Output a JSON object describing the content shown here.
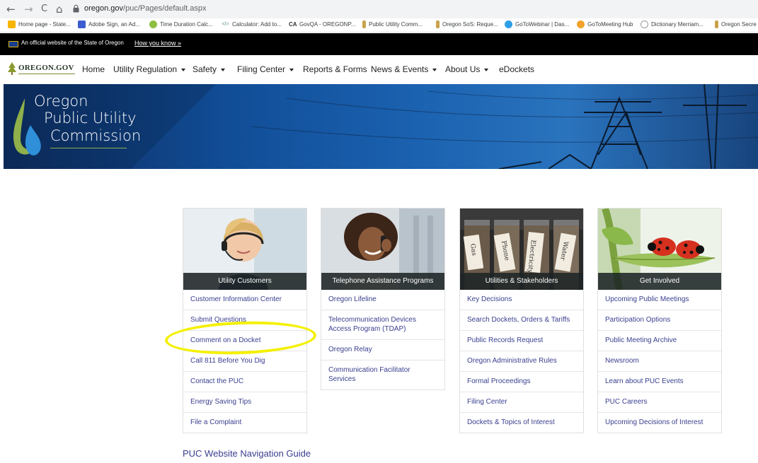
{
  "browser": {
    "nav": {
      "back": "←",
      "forward": "→",
      "reload": "C",
      "home": "⌂"
    },
    "url_domain": "oregon.gov",
    "url_path": "/puc/Pages/default.aspx",
    "bookmarks": [
      "Home page - State...",
      "Adobe Sign, an Ad...",
      "Time Duration Calc...",
      "Calculator: Add to...",
      "GovQA - OREGONP...",
      "Public Utility Comm...",
      "Oregon SoS: Reque...",
      "GoToWebinar | Das...",
      "GoToMeeting Hub",
      "Dictionary Merriam...",
      "Oregon Secre"
    ]
  },
  "official_bar": {
    "text": "An official website of the State of Oregon",
    "link": "How you know »"
  },
  "site": {
    "logo": "OREGON.GOV",
    "nav": [
      {
        "label": "Home",
        "dropdown": false
      },
      {
        "label": "Utility Regulation",
        "dropdown": true
      },
      {
        "label": "Safety",
        "dropdown": true
      },
      {
        "label": "Filing Center",
        "dropdown": true
      },
      {
        "label": "Reports & Forms",
        "dropdown": false
      },
      {
        "label": "News & Events",
        "dropdown": true
      },
      {
        "label": "About Us",
        "dropdown": true
      },
      {
        "label": "eDockets",
        "dropdown": false
      }
    ]
  },
  "banner": {
    "line1": "Oregon",
    "line2": "Public Utility",
    "line3": "Commission"
  },
  "cards": [
    {
      "caption": "Utility Customers",
      "links": [
        "Customer Information Center",
        "Submit Questions",
        "Comment on a Docket",
        "Call 811 Before You Dig",
        "Contact the PUC",
        "Energy Saving Tips",
        "File a Complaint"
      ]
    },
    {
      "caption": "Telephone Assistance Programs",
      "links": [
        "Oregon Lifeline",
        "Telecommunication Devices Access Program (TDAP)",
        "Oregon Relay",
        "Communication Facilitator Services"
      ]
    },
    {
      "caption": "Utilities & Stakeholders",
      "links": [
        "Key Decisions",
        "Search Dockets, Orders & Tariffs",
        "Public Records Request",
        "Oregon Administrative Rules",
        "Formal Proceedings",
        "Filing Center",
        "Dockets & Topics of Interest"
      ]
    },
    {
      "caption": "Get Involved",
      "links": [
        "Upcoming Public Meetings",
        "Participation Options",
        "Public Meeting Archive",
        "Newsroom",
        "Learn about PUC Events",
        "PUC Careers",
        "Upcoming Decisions of Interest"
      ]
    }
  ],
  "jar_labels": [
    "Gas",
    "Phone",
    "Electricity",
    "Water"
  ],
  "footer_link": "PUC Website Navigation Guide"
}
